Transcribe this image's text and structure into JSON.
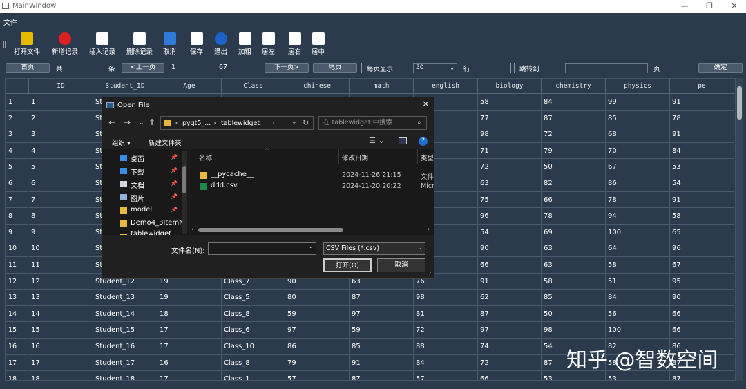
{
  "window": {
    "title": "MainWindow"
  },
  "menu": {
    "file": "文件"
  },
  "toolbar": [
    {
      "label": "打开文件",
      "icon": "open-file-icon",
      "color": "#e6b800"
    },
    {
      "label": "新增记录",
      "icon": "add-record-icon",
      "color": "#e02020"
    },
    {
      "label": "插入记录",
      "icon": "insert-record-icon",
      "color": "#ffffff"
    },
    {
      "label": "删除记录",
      "icon": "delete-record-icon",
      "color": "#ffffff"
    },
    {
      "label": "取消",
      "icon": "undo-icon",
      "color": "#2f7bd8"
    },
    {
      "label": "保存",
      "icon": "save-icon",
      "color": "#ffffff"
    },
    {
      "label": "退出",
      "icon": "exit-icon",
      "color": "#1e64c8"
    },
    {
      "label": "加粗",
      "icon": "bold-icon",
      "color": "#ffffff"
    },
    {
      "label": "居左",
      "icon": "align-left-icon",
      "color": "#ffffff"
    },
    {
      "label": "居右",
      "icon": "align-right-icon",
      "color": "#ffffff"
    },
    {
      "label": "居中",
      "icon": "align-center-icon",
      "color": "#ffffff"
    }
  ],
  "pager": {
    "first": "首页",
    "total_label": "共",
    "total_unit": "条",
    "prev": "<上一页",
    "current_page": "1",
    "total_count": "67",
    "next": "下一页>",
    "last": "尾页",
    "per_page_label": "每页显示",
    "per_page_value": "50",
    "per_page_unit": "行",
    "jump_label": "跳转到",
    "page_unit": "页",
    "confirm": "确定"
  },
  "table": {
    "headers": [
      "ID",
      "Student_ID",
      "Age",
      "Class",
      "chinese",
      "math",
      "english",
      "biology",
      "chemistry",
      "physics",
      "pe"
    ],
    "rows": [
      [
        "1",
        "St",
        "",
        "",
        "",
        "",
        "",
        "58",
        "84",
        "99",
        "91"
      ],
      [
        "2",
        "St",
        "",
        "",
        "",
        "",
        "",
        "77",
        "87",
        "85",
        "78"
      ],
      [
        "3",
        "St",
        "",
        "",
        "",
        "",
        "",
        "98",
        "72",
        "68",
        "91"
      ],
      [
        "4",
        "St",
        "",
        "",
        "",
        "",
        "",
        "71",
        "79",
        "70",
        "84"
      ],
      [
        "5",
        "St",
        "",
        "",
        "",
        "",
        "",
        "72",
        "50",
        "67",
        "53"
      ],
      [
        "6",
        "St",
        "",
        "",
        "",
        "",
        "",
        "63",
        "82",
        "86",
        "54"
      ],
      [
        "7",
        "St",
        "",
        "",
        "",
        "",
        "",
        "75",
        "66",
        "78",
        "91"
      ],
      [
        "8",
        "St",
        "",
        "",
        "",
        "",
        "",
        "96",
        "78",
        "94",
        "58"
      ],
      [
        "9",
        "St",
        "",
        "",
        "",
        "",
        "",
        "54",
        "69",
        "100",
        "65"
      ],
      [
        "10",
        "St",
        "",
        "",
        "",
        "",
        "",
        "90",
        "63",
        "64",
        "96"
      ],
      [
        "11",
        "St",
        "",
        "",
        "",
        "",
        "",
        "66",
        "63",
        "58",
        "67"
      ],
      [
        "12",
        "Student_12",
        "19",
        "Class_7",
        "90",
        "63",
        "76",
        "91",
        "58",
        "51",
        "95"
      ],
      [
        "13",
        "Student_13",
        "19",
        "Class_5",
        "80",
        "87",
        "98",
        "62",
        "85",
        "84",
        "90"
      ],
      [
        "14",
        "Student_14",
        "18",
        "Class_8",
        "59",
        "97",
        "81",
        "87",
        "50",
        "56",
        "66"
      ],
      [
        "15",
        "Student_15",
        "17",
        "Class_6",
        "97",
        "59",
        "72",
        "97",
        "98",
        "100",
        "66"
      ],
      [
        "16",
        "Student_16",
        "17",
        "Class_10",
        "86",
        "85",
        "88",
        "74",
        "54",
        "82",
        "86"
      ],
      [
        "17",
        "Student_17",
        "16",
        "Class_8",
        "79",
        "91",
        "84",
        "72",
        "87",
        "58",
        "87"
      ],
      [
        "18",
        "Student_18",
        "17",
        "Class_1",
        "57",
        "87",
        "57",
        "66",
        "53",
        "53",
        "87"
      ]
    ]
  },
  "dialog": {
    "title": "Open File",
    "breadcrumb": [
      "«",
      "pyqt5_...",
      "›",
      "tablewidget",
      "›"
    ],
    "search_placeholder": "在 tablewidget 中搜索",
    "organize": "组织 ▾",
    "new_folder": "新建文件夹",
    "sidebar": [
      "桌面",
      "下载",
      "文档",
      "图片",
      "model",
      "Demo4_3ItemM",
      "tablewidget"
    ],
    "columns": [
      "名称",
      "修改日期",
      "类型"
    ],
    "files": [
      {
        "name": "__pycache__",
        "date": "2024-11-26 21:15",
        "type": "文件",
        "icon": "folder-icon"
      },
      {
        "name": "ddd.csv",
        "date": "2024-11-20 20:22",
        "type": "Micr",
        "icon": "excel-file-icon"
      }
    ],
    "filename_label": "文件名(N):",
    "filename_value": "",
    "filter": "CSV Files (*.csv)",
    "open": "打开(O)",
    "cancel": "取消"
  },
  "watermark": "知乎 @智数空间"
}
